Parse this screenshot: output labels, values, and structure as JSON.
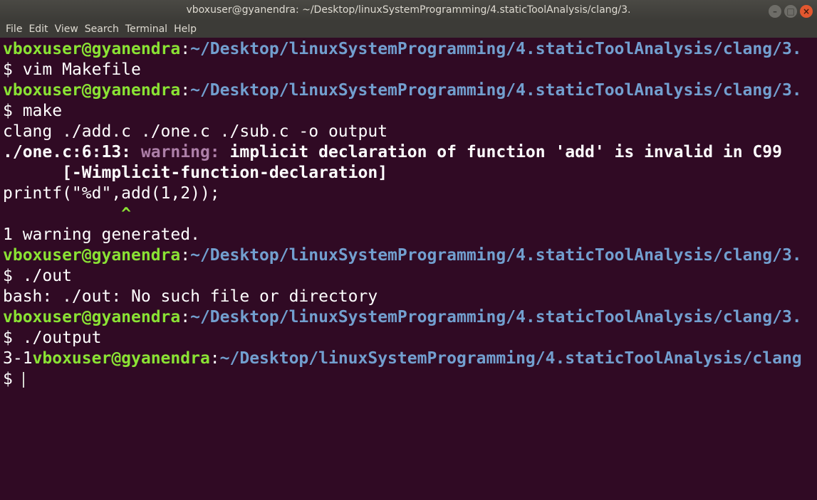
{
  "window": {
    "title": "vboxuser@gyanendra: ~/Desktop/linuxSystemProgramming/4.staticToolAnalysis/clang/3.",
    "buttons": {
      "minimize": "–",
      "maximize": "□",
      "close": "×"
    }
  },
  "menu": [
    "File",
    "Edit",
    "View",
    "Search",
    "Terminal",
    "Help"
  ],
  "terminal": {
    "user": "vboxuser@gyanendra",
    "colon": ":",
    "path": "~/Desktop/linuxSystemProgramming/4.staticToolAnalysis/clang/3.",
    "path_wrapped": "~/Desktop/linuxSystemProgramming/4.staticToolAnalysis/clang",
    "prompt_symbol": "$ ",
    "cmd1": "vim Makefile",
    "cmd2": "make",
    "compile_line": "clang ./add.c ./one.c ./sub.c -o output",
    "warn_loc": "./one.c:6:13: ",
    "warn_label": "warning: ",
    "warn_msg": "implicit declaration of function 'add' is invalid in C99",
    "warn_flag": "      [-Wimplicit-function-declaration]",
    "code_line": "printf(\"%d\",add(1,2));",
    "caret_pad": "            ",
    "caret": "^",
    "warn_count": "1 warning generated.",
    "cmd3": "./out",
    "error_line": "bash: ./out: No such file or directory",
    "cmd4": "./output",
    "program_output": "3-1"
  },
  "colors": {
    "background": "#300a24",
    "user": "#8ae234",
    "path": "#729fcf",
    "warning": "#ad7fa8",
    "text": "#ffffff"
  }
}
